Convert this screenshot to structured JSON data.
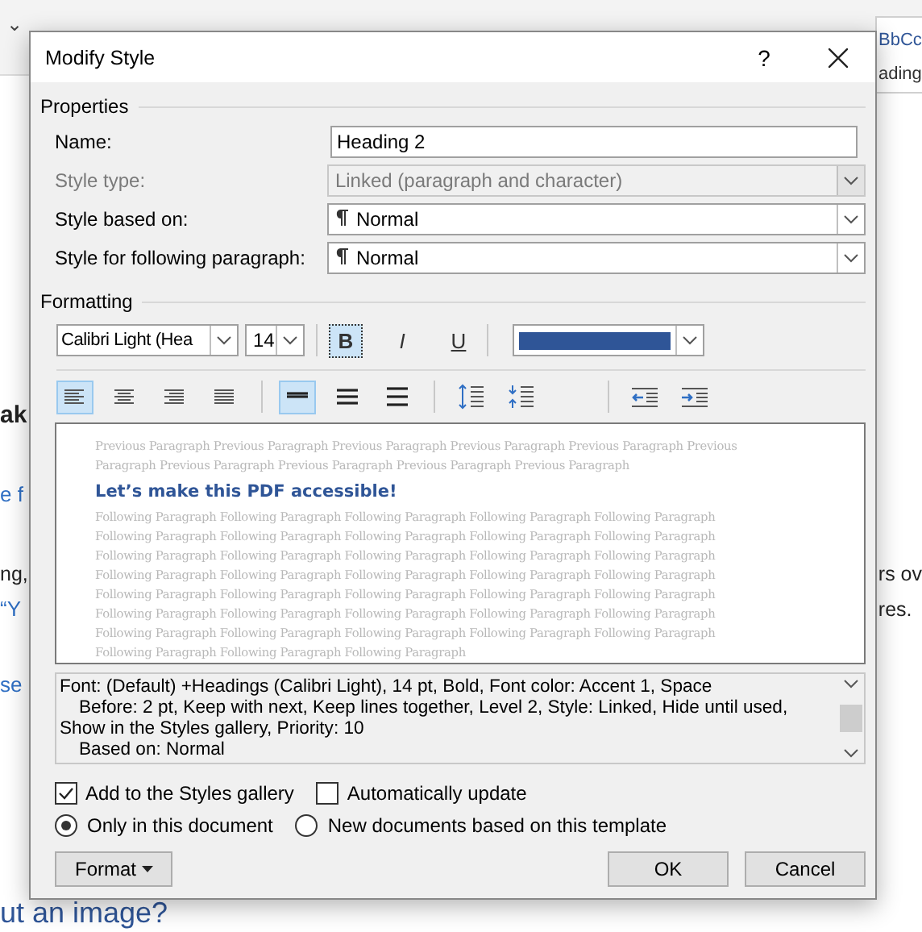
{
  "background": {
    "ribbon_left": "⌄",
    "styles_gallery": [
      {
        "text": "BbCc",
        "kind": "sample"
      },
      {
        "text": "ading",
        "kind": "caption"
      }
    ],
    "left_fragments": [
      {
        "text": "ak",
        "kind": "heading"
      },
      {
        "text": "e f",
        "kind": "link"
      },
      {
        "text": "ng,",
        "kind": "body"
      },
      {
        "text": "“Y",
        "kind": "link"
      },
      {
        "text": "se",
        "kind": "link"
      },
      {
        "text": "ut an image?",
        "kind": "subheading"
      }
    ],
    "right_fragments": [
      {
        "text": "rs ov",
        "kind": "body"
      },
      {
        "text": "res.",
        "kind": "body"
      }
    ]
  },
  "dialog": {
    "title": "Modify Style",
    "help": "?",
    "properties": {
      "heading": "Properties",
      "fields": [
        {
          "label": "Name:",
          "value": "Heading 2",
          "kind": "text",
          "disabled": false
        },
        {
          "label": "Style type:",
          "value": "Linked (paragraph and character)",
          "kind": "combo",
          "disabled": true
        },
        {
          "label": "Style based on:",
          "value": "Normal",
          "kind": "paragraph-combo",
          "disabled": false
        },
        {
          "label": "Style for following paragraph:",
          "value": "Normal",
          "kind": "paragraph-combo",
          "disabled": false
        }
      ]
    },
    "formatting": {
      "heading": "Formatting",
      "font": "Calibri Light (Hea",
      "size": "14",
      "styles": [
        {
          "label": "B",
          "kind": "bold",
          "selected": true
        },
        {
          "label": "I",
          "kind": "italic",
          "selected": false
        },
        {
          "label": "U",
          "kind": "underline",
          "selected": false
        }
      ],
      "color": "#2f5597",
      "alignment": [
        {
          "kind": "left",
          "selected": true
        },
        {
          "kind": "center",
          "selected": false
        },
        {
          "kind": "right",
          "selected": false
        },
        {
          "kind": "justify",
          "selected": false
        }
      ],
      "line_spacing": [
        {
          "kind": "single",
          "selected": true
        },
        {
          "kind": "one-half",
          "selected": false
        },
        {
          "kind": "double",
          "selected": false
        }
      ],
      "paragraph_spacing": [
        {
          "kind": "increase",
          "selected": false
        },
        {
          "kind": "decrease",
          "selected": false
        }
      ],
      "indent": [
        {
          "kind": "decrease",
          "selected": false
        },
        {
          "kind": "increase",
          "selected": false
        }
      ]
    },
    "preview": {
      "previous": [
        "Previous Paragraph Previous Paragraph Previous Paragraph Previous Paragraph Previous Paragraph Previous",
        "Paragraph Previous Paragraph Previous Paragraph Previous Paragraph Previous Paragraph"
      ],
      "sample": "Let’s make this PDF accessible!",
      "following": [
        "Following Paragraph Following Paragraph Following Paragraph Following Paragraph Following Paragraph",
        "Following Paragraph Following Paragraph Following Paragraph Following Paragraph Following Paragraph",
        "Following Paragraph Following Paragraph Following Paragraph Following Paragraph Following Paragraph",
        "Following Paragraph Following Paragraph Following Paragraph Following Paragraph Following Paragraph",
        "Following Paragraph Following Paragraph Following Paragraph Following Paragraph Following Paragraph",
        "Following Paragraph Following Paragraph Following Paragraph Following Paragraph Following Paragraph",
        "Following Paragraph Following Paragraph Following Paragraph Following Paragraph Following Paragraph",
        "Following Paragraph Following Paragraph Following Paragraph"
      ]
    },
    "description": [
      {
        "text": "Font: (Default) +Headings (Calibri Light), 14 pt, Bold, Font color: Accent 1, Space",
        "indented": false
      },
      {
        "text": "Before:  2 pt, Keep with next, Keep lines together, Level 2, Style: Linked, Hide until used,",
        "indented": true
      },
      {
        "text": "Show in the Styles gallery, Priority: 10",
        "indented": false
      },
      {
        "text": "Based on: Normal",
        "indented": true
      }
    ],
    "checkboxes": [
      {
        "label": "Add to the Styles gallery",
        "checked": true
      },
      {
        "label": "Automatically update",
        "checked": false
      }
    ],
    "radios": [
      {
        "label": "Only in this document",
        "selected": true
      },
      {
        "label": "New documents based on this template",
        "selected": false
      }
    ],
    "format_button": "Format",
    "buttons": [
      "OK",
      "Cancel"
    ]
  }
}
